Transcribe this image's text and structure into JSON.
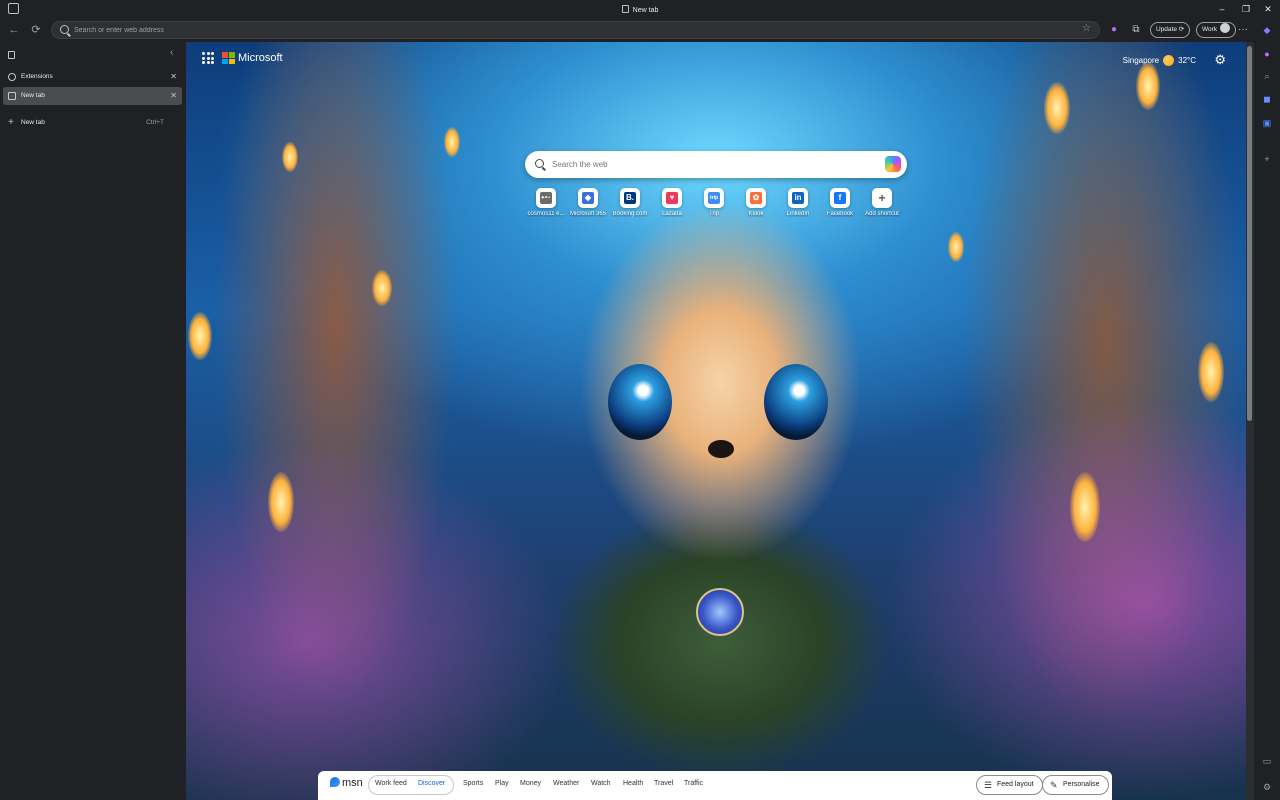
{
  "window": {
    "title": "New tab",
    "minimize": "–",
    "restore": "❐",
    "close": "✕"
  },
  "toolbar": {
    "back": "←",
    "refresh": "⟳",
    "address_placeholder": "Search or enter web address",
    "favorite": "☆",
    "update_label": "Update",
    "profile_label": "Work",
    "more": "···"
  },
  "sidebar": {
    "collapse": "‹",
    "tabs": [
      {
        "label": "Extensions",
        "active": false
      },
      {
        "label": "New tab",
        "active": true
      }
    ],
    "new_tab": {
      "label": "New tab",
      "shortcut": "Ctrl+T"
    }
  },
  "newtab": {
    "brand": "Microsoft",
    "weather": {
      "city": "Singapore",
      "temp": "32°C"
    },
    "search_placeholder": "Search the web",
    "shortcuts": [
      {
        "label": "cosmos11 e...",
        "glyph": "•⁃·",
        "color": "#6b6b6b"
      },
      {
        "label": "Microsoft 365",
        "glyph": "◆",
        "color": "#3b6fe0"
      },
      {
        "label": "Booking.com",
        "glyph": "B.",
        "color": "#003580"
      },
      {
        "label": "Lazada",
        "glyph": "♥",
        "color": "#f0365b"
      },
      {
        "label": "Trip",
        "glyph": "trip",
        "color": "#3f8ef5"
      },
      {
        "label": "Klook",
        "glyph": "✿",
        "color": "#ff6c3a"
      },
      {
        "label": "LinkedIn",
        "glyph": "in",
        "color": "#0a66c2"
      },
      {
        "label": "Facebook",
        "glyph": "f",
        "color": "#1877f2"
      },
      {
        "label": "Add shortcut",
        "glyph": "+",
        "color": "#555555"
      }
    ]
  },
  "msn": {
    "logo": "msn",
    "segments": [
      "Work feed",
      "Discover"
    ],
    "nav": [
      "Sports",
      "Play",
      "Money",
      "Weather",
      "Watch",
      "Health",
      "Travel",
      "Traffic"
    ],
    "feed_layout": "Feed layout",
    "personalise": "Personalise"
  }
}
